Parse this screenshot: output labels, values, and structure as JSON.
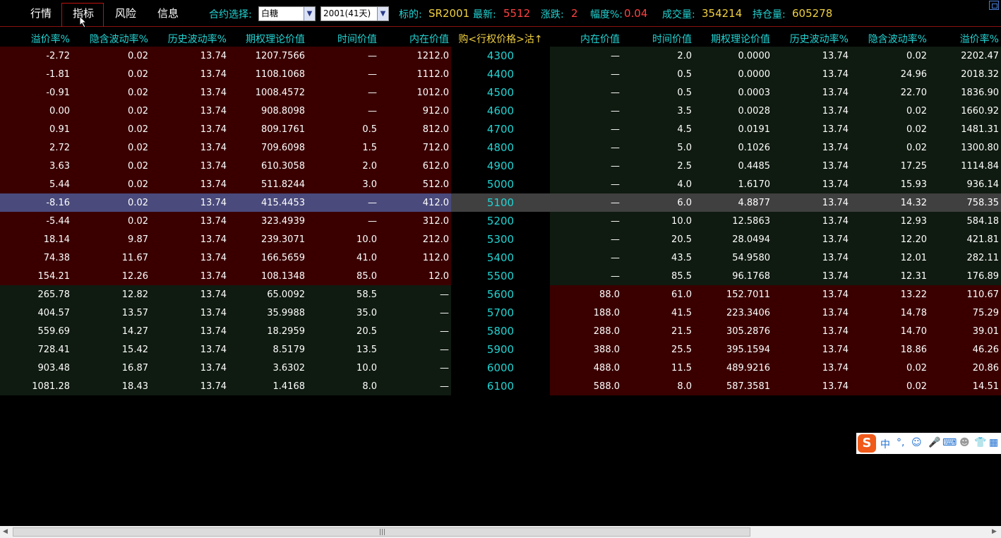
{
  "tabs": [
    "行情",
    "指标",
    "风险",
    "信息"
  ],
  "contract_label": "合约选择:",
  "commodity_select": "白糖",
  "month_select": "2001(41天)",
  "underlying_label": "标的:",
  "underlying_value": "SR2001",
  "latest_label": "最新:",
  "latest_value": "5512",
  "change_label": "涨跌:",
  "change_value": "2",
  "pct_label": "幅度%:",
  "pct_value": "0.04",
  "volume_label": "成交量:",
  "volume_value": "354214",
  "oi_label": "持仓量:",
  "oi_value": "605278",
  "call_headers": [
    "溢价率%",
    "隐含波动率%",
    "历史波动率%",
    "期权理论价值",
    "时间价值",
    "内在价值"
  ],
  "strike_header": "购<行权价格>沽↑",
  "put_headers": [
    "内在价值",
    "时间价值",
    "期权理论价值",
    "历史波动率%",
    "隐含波动率%",
    "溢价率%"
  ],
  "rows": [
    {
      "call": [
        "-2.72",
        "0.02",
        "13.74",
        "1207.7566",
        "—",
        "1212.0"
      ],
      "strike": "4300",
      "put": [
        "—",
        "2.0",
        "0.0000",
        "13.74",
        "0.02",
        "2202.47"
      ]
    },
    {
      "call": [
        "-1.81",
        "0.02",
        "13.74",
        "1108.1068",
        "—",
        "1112.0"
      ],
      "strike": "4400",
      "put": [
        "—",
        "0.5",
        "0.0000",
        "13.74",
        "24.96",
        "2018.32"
      ]
    },
    {
      "call": [
        "-0.91",
        "0.02",
        "13.74",
        "1008.4572",
        "—",
        "1012.0"
      ],
      "strike": "4500",
      "put": [
        "—",
        "0.5",
        "0.0003",
        "13.74",
        "22.70",
        "1836.90"
      ]
    },
    {
      "call": [
        "0.00",
        "0.02",
        "13.74",
        "908.8098",
        "—",
        "912.0"
      ],
      "strike": "4600",
      "put": [
        "—",
        "3.5",
        "0.0028",
        "13.74",
        "0.02",
        "1660.92"
      ]
    },
    {
      "call": [
        "0.91",
        "0.02",
        "13.74",
        "809.1761",
        "0.5",
        "812.0"
      ],
      "strike": "4700",
      "put": [
        "—",
        "4.5",
        "0.0191",
        "13.74",
        "0.02",
        "1481.31"
      ]
    },
    {
      "call": [
        "2.72",
        "0.02",
        "13.74",
        "709.6098",
        "1.5",
        "712.0"
      ],
      "strike": "4800",
      "put": [
        "—",
        "5.0",
        "0.1026",
        "13.74",
        "0.02",
        "1300.80"
      ]
    },
    {
      "call": [
        "3.63",
        "0.02",
        "13.74",
        "610.3058",
        "2.0",
        "612.0"
      ],
      "strike": "4900",
      "put": [
        "—",
        "2.5",
        "0.4485",
        "13.74",
        "17.25",
        "1114.84"
      ]
    },
    {
      "call": [
        "5.44",
        "0.02",
        "13.74",
        "511.8244",
        "3.0",
        "512.0"
      ],
      "strike": "5000",
      "put": [
        "—",
        "4.0",
        "1.6170",
        "13.74",
        "15.93",
        "936.14"
      ]
    },
    {
      "call": [
        "-8.16",
        "0.02",
        "13.74",
        "415.4453",
        "—",
        "412.0"
      ],
      "strike": "5100",
      "put": [
        "—",
        "6.0",
        "4.8877",
        "13.74",
        "14.32",
        "758.35"
      ]
    },
    {
      "call": [
        "-5.44",
        "0.02",
        "13.74",
        "323.4939",
        "—",
        "312.0"
      ],
      "strike": "5200",
      "put": [
        "—",
        "10.0",
        "12.5863",
        "13.74",
        "12.93",
        "584.18"
      ]
    },
    {
      "call": [
        "18.14",
        "9.87",
        "13.74",
        "239.3071",
        "10.0",
        "212.0"
      ],
      "strike": "5300",
      "put": [
        "—",
        "20.5",
        "28.0494",
        "13.74",
        "12.20",
        "421.81"
      ]
    },
    {
      "call": [
        "74.38",
        "11.67",
        "13.74",
        "166.5659",
        "41.0",
        "112.0"
      ],
      "strike": "5400",
      "put": [
        "—",
        "43.5",
        "54.9580",
        "13.74",
        "12.01",
        "282.11"
      ]
    },
    {
      "call": [
        "154.21",
        "12.26",
        "13.74",
        "108.1348",
        "85.0",
        "12.0"
      ],
      "strike": "5500",
      "put": [
        "—",
        "85.5",
        "96.1768",
        "13.74",
        "12.31",
        "176.89"
      ]
    },
    {
      "call": [
        "265.78",
        "12.82",
        "13.74",
        "65.0092",
        "58.5",
        "—"
      ],
      "strike": "5600",
      "put": [
        "88.0",
        "61.0",
        "152.7011",
        "13.74",
        "13.22",
        "110.67"
      ]
    },
    {
      "call": [
        "404.57",
        "13.57",
        "13.74",
        "35.9988",
        "35.0",
        "—"
      ],
      "strike": "5700",
      "put": [
        "188.0",
        "41.5",
        "223.3406",
        "13.74",
        "14.78",
        "75.29"
      ]
    },
    {
      "call": [
        "559.69",
        "14.27",
        "13.74",
        "18.2959",
        "20.5",
        "—"
      ],
      "strike": "5800",
      "put": [
        "288.0",
        "21.5",
        "305.2876",
        "13.74",
        "14.70",
        "39.01"
      ]
    },
    {
      "call": [
        "728.41",
        "15.42",
        "13.74",
        "8.5179",
        "13.5",
        "—"
      ],
      "strike": "5900",
      "put": [
        "388.0",
        "25.5",
        "395.1594",
        "13.74",
        "18.86",
        "46.26"
      ]
    },
    {
      "call": [
        "903.48",
        "16.87",
        "13.74",
        "3.6302",
        "10.0",
        "—"
      ],
      "strike": "6000",
      "put": [
        "488.0",
        "11.5",
        "489.9216",
        "13.74",
        "0.02",
        "20.86"
      ]
    },
    {
      "call": [
        "1081.28",
        "18.43",
        "13.74",
        "1.4168",
        "8.0",
        "—"
      ],
      "strike": "6100",
      "put": [
        "588.0",
        "8.0",
        "587.3581",
        "13.74",
        "0.02",
        "14.51"
      ]
    }
  ],
  "ime": {
    "logo": "S",
    "mode": "中",
    "punct": "°,"
  },
  "colors": {
    "accent": "#22d3d3",
    "value_yellow": "#f0d040",
    "value_red": "#ff4040",
    "itm_bg": "#3a0000",
    "otm_bg": "#0f1a10",
    "highlight_call": "#4a4a7c",
    "highlight_put": "#404040"
  }
}
